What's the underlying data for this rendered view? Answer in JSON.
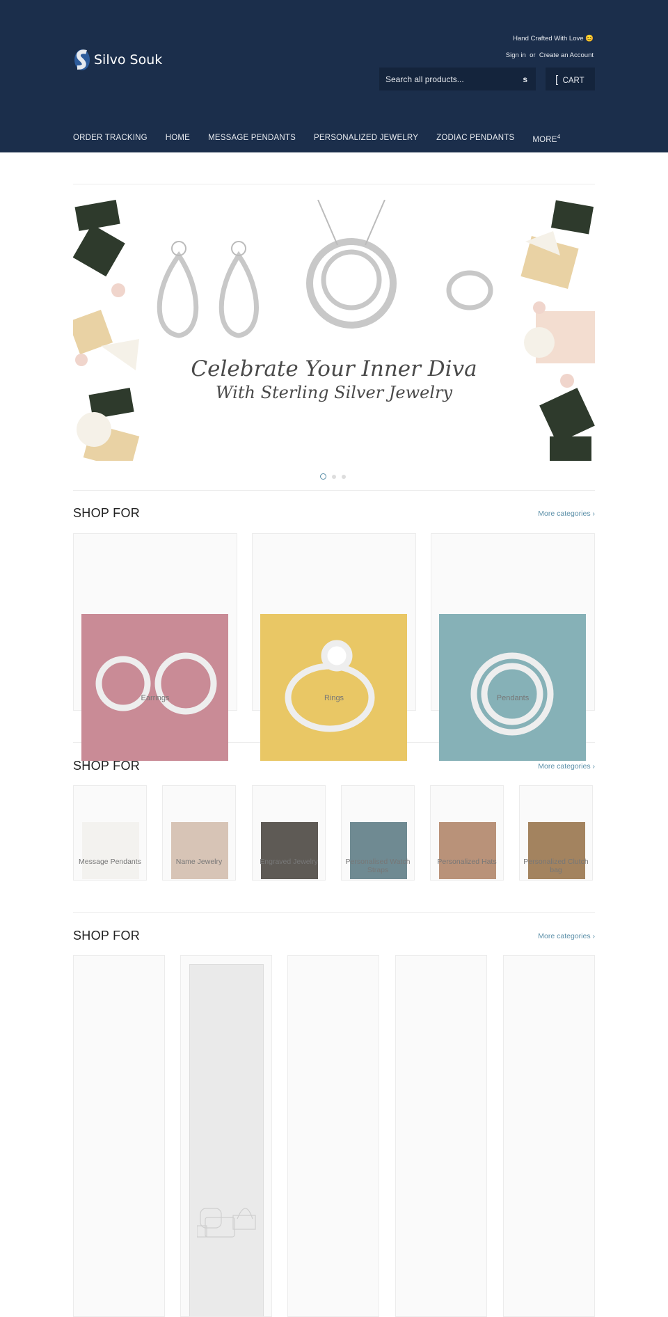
{
  "header": {
    "logo_text": "Silvo Souk",
    "tagline": "Hand Crafted With Love 😊",
    "sign_in": "Sign in",
    "or": "or",
    "create_account": "Create an Account",
    "search_placeholder": "Search all products...",
    "search_icon_glyph": "s",
    "cart_icon_glyph": "[",
    "cart_label": "CART",
    "nav": [
      "ORDER TRACKING",
      "HOME",
      "MESSAGE PENDANTS",
      "PERSONALIZED JEWELRY",
      "ZODIAC PENDANTS",
      "MORE"
    ],
    "more_glyph": "4",
    "bg_color": "#1b2e4b"
  },
  "banner": {
    "line1": "Celebrate Your Inner Diva",
    "line2": "With Sterling Silver Jewelry",
    "slides": 3,
    "active_slide": 1
  },
  "sections": [
    {
      "title": "SHOP FOR",
      "more": "More categories ›",
      "items": [
        {
          "label": "Earrings",
          "color": "#c98b96"
        },
        {
          "label": "Rings",
          "color": "#e9c765"
        },
        {
          "label": "Pendants",
          "color": "#86b1b7"
        }
      ]
    },
    {
      "title": "SHOP FOR",
      "more": "More categories ›",
      "items": [
        {
          "label": "Message Pendants",
          "color": "#f3f2ef"
        },
        {
          "label": "Name Jewelry",
          "color": "#d7c4b6"
        },
        {
          "label": "Engraved Jewelry",
          "color": "#5e5a55"
        },
        {
          "label": "Personalised Watch Straps",
          "color": "#6f8a92"
        },
        {
          "label": "Personalized Hats",
          "color": "#b99279"
        },
        {
          "label": "Personalized Clutch bag",
          "color": "#a3835f"
        }
      ]
    },
    {
      "title": "SHOP FOR",
      "more": "More categories ›",
      "items": [
        {},
        {
          "placeholder": "bags-placeholder-icon"
        },
        {},
        {},
        {}
      ]
    }
  ],
  "accent_color": "#5b8fa8"
}
